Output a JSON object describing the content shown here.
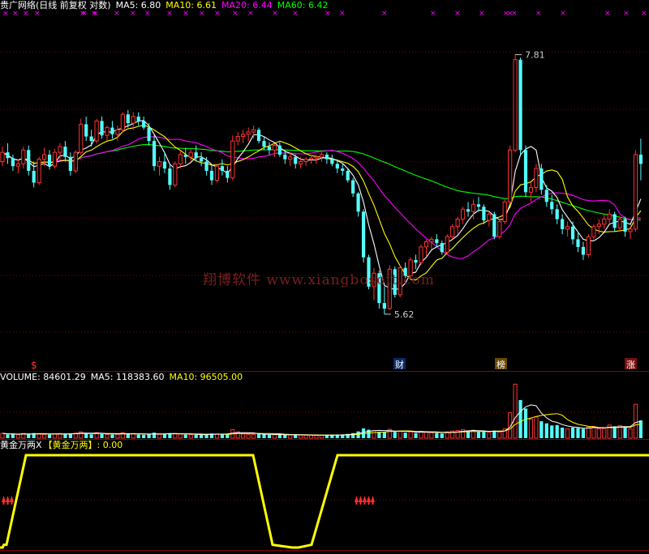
{
  "price_header": {
    "title": "贵广网络(日线 前复权 对数)",
    "ma5": "MA5: 6.80",
    "ma10": "MA10: 6.61",
    "ma20": "MA20: 6.44",
    "ma60": "MA60: 6.42"
  },
  "volume_header": {
    "volume": "VOLUME: 84601.29",
    "ma5": "MA5: 118383.60",
    "ma10": "MA10: 96505.00"
  },
  "indicator_header": {
    "name": "黄金万两X",
    "line": "【黄金万两】: 0.00"
  },
  "watermark": "翔博软件 www.xiangbosoft.com",
  "price_annotations": {
    "high_label": "7.81",
    "low_label": "5.62",
    "marker_s": "$",
    "marker_cai": "财",
    "marker_bang": "榜",
    "marker_zhang": "涨"
  },
  "colors": {
    "background": "#000000",
    "up": "#ff3232",
    "down": "#54ffff",
    "ma5": "#ffffff",
    "ma10": "#ffff00",
    "ma20": "#ff00ff",
    "ma60": "#00ff00",
    "signal": "#ffff00",
    "grid": "#8b0000",
    "marker_x": "#ff00ff"
  },
  "chart_data": {
    "type": "candlestick",
    "scale": "log",
    "ylim": [
      5.3,
      8.2
    ],
    "candles": [
      [
        6.82,
        6.95,
        6.78,
        6.9
      ],
      [
        6.9,
        6.98,
        6.8,
        6.85
      ],
      [
        6.85,
        6.88,
        6.74,
        6.78
      ],
      [
        6.78,
        6.84,
        6.72,
        6.8
      ],
      [
        6.8,
        6.95,
        6.76,
        6.92
      ],
      [
        6.92,
        6.96,
        6.7,
        6.74
      ],
      [
        6.74,
        6.82,
        6.6,
        6.64
      ],
      [
        6.64,
        6.86,
        6.62,
        6.84
      ],
      [
        6.84,
        6.94,
        6.78,
        6.88
      ],
      [
        6.88,
        6.92,
        6.75,
        6.78
      ],
      [
        6.78,
        6.93,
        6.76,
        6.9
      ],
      [
        6.9,
        6.98,
        6.84,
        6.95
      ],
      [
        6.95,
        7.0,
        6.82,
        6.86
      ],
      [
        6.86,
        6.9,
        6.7,
        6.74
      ],
      [
        6.74,
        6.92,
        6.72,
        6.9
      ],
      [
        6.9,
        7.2,
        6.88,
        7.15
      ],
      [
        7.15,
        7.22,
        7.0,
        7.04
      ],
      [
        7.04,
        7.1,
        6.95,
        7.0
      ],
      [
        7.0,
        7.2,
        6.98,
        7.18
      ],
      [
        7.18,
        7.22,
        7.02,
        7.05
      ],
      [
        7.05,
        7.14,
        7.0,
        7.12
      ],
      [
        7.12,
        7.18,
        7.02,
        7.06
      ],
      [
        7.06,
        7.14,
        7.0,
        7.1
      ],
      [
        7.1,
        7.26,
        7.08,
        7.24
      ],
      [
        7.24,
        7.28,
        7.12,
        7.16
      ],
      [
        7.16,
        7.26,
        7.1,
        7.22
      ],
      [
        7.22,
        7.26,
        7.14,
        7.18
      ],
      [
        7.18,
        7.22,
        7.1,
        7.12
      ],
      [
        7.12,
        7.16,
        6.96,
        7.0
      ],
      [
        7.0,
        7.05,
        6.74,
        6.78
      ],
      [
        6.78,
        6.86,
        6.7,
        6.82
      ],
      [
        6.82,
        6.9,
        6.72,
        6.76
      ],
      [
        6.76,
        6.8,
        6.58,
        6.62
      ],
      [
        6.62,
        6.82,
        6.6,
        6.8
      ],
      [
        6.8,
        6.92,
        6.76,
        6.88
      ],
      [
        6.88,
        6.94,
        6.8,
        6.86
      ],
      [
        6.86,
        6.93,
        6.82,
        6.9
      ],
      [
        6.9,
        6.96,
        6.82,
        6.85
      ],
      [
        6.85,
        6.9,
        6.78,
        6.82
      ],
      [
        6.82,
        6.86,
        6.7,
        6.74
      ],
      [
        6.74,
        6.8,
        6.62,
        6.66
      ],
      [
        6.66,
        6.8,
        6.64,
        6.78
      ],
      [
        6.78,
        6.84,
        6.7,
        6.74
      ],
      [
        6.74,
        6.78,
        6.64,
        6.68
      ],
      [
        6.68,
        7.05,
        6.66,
        7.0
      ],
      [
        7.0,
        7.08,
        6.96,
        7.04
      ],
      [
        7.04,
        7.1,
        6.98,
        7.06
      ],
      [
        7.06,
        7.12,
        7.0,
        7.08
      ],
      [
        7.08,
        7.14,
        7.02,
        7.1
      ],
      [
        7.1,
        7.12,
        6.98,
        7.0
      ],
      [
        7.0,
        7.04,
        6.92,
        6.95
      ],
      [
        6.95,
        6.99,
        6.88,
        6.92
      ],
      [
        6.92,
        6.98,
        6.86,
        6.96
      ],
      [
        6.96,
        6.99,
        6.86,
        6.88
      ],
      [
        6.88,
        6.92,
        6.8,
        6.84
      ],
      [
        6.84,
        6.9,
        6.78,
        6.86
      ],
      [
        6.86,
        6.88,
        6.76,
        6.8
      ],
      [
        6.8,
        6.86,
        6.76,
        6.82
      ],
      [
        6.82,
        6.86,
        6.78,
        6.84
      ],
      [
        6.84,
        6.88,
        6.8,
        6.85
      ],
      [
        6.85,
        6.88,
        6.8,
        6.86
      ],
      [
        6.86,
        6.9,
        6.82,
        6.88
      ],
      [
        6.88,
        6.9,
        6.8,
        6.84
      ],
      [
        6.84,
        6.88,
        6.78,
        6.8
      ],
      [
        6.8,
        6.84,
        6.72,
        6.76
      ],
      [
        6.76,
        6.8,
        6.7,
        6.74
      ],
      [
        6.74,
        6.76,
        6.64,
        6.66
      ],
      [
        6.66,
        6.68,
        6.52,
        6.55
      ],
      [
        6.55,
        6.56,
        6.36,
        6.4
      ],
      [
        6.4,
        6.42,
        6.0,
        6.04
      ],
      [
        6.04,
        6.06,
        5.8,
        5.82
      ],
      [
        5.82,
        5.96,
        5.72,
        5.92
      ],
      [
        5.92,
        5.94,
        5.66,
        5.7
      ],
      [
        5.7,
        5.82,
        5.62,
        5.66
      ],
      [
        5.66,
        5.98,
        5.65,
        5.95
      ],
      [
        5.95,
        5.97,
        5.74,
        5.76
      ],
      [
        5.76,
        5.98,
        5.74,
        5.96
      ],
      [
        5.96,
        6.0,
        5.88,
        5.9
      ],
      [
        5.9,
        6.04,
        5.88,
        6.02
      ],
      [
        6.02,
        6.06,
        5.95,
        6.0
      ],
      [
        6.0,
        6.14,
        5.98,
        6.12
      ],
      [
        6.12,
        6.18,
        6.05,
        6.16
      ],
      [
        6.16,
        6.2,
        6.1,
        6.18
      ],
      [
        6.18,
        6.22,
        6.12,
        6.15
      ],
      [
        6.15,
        6.17,
        6.06,
        6.08
      ],
      [
        6.08,
        6.22,
        6.06,
        6.2
      ],
      [
        6.2,
        6.3,
        6.18,
        6.28
      ],
      [
        6.28,
        6.36,
        6.22,
        6.34
      ],
      [
        6.34,
        6.44,
        6.3,
        6.42
      ],
      [
        6.42,
        6.48,
        6.36,
        6.4
      ],
      [
        6.4,
        6.5,
        6.34,
        6.46
      ],
      [
        6.46,
        6.52,
        6.4,
        6.44
      ],
      [
        6.44,
        6.46,
        6.3,
        6.33
      ],
      [
        6.33,
        6.4,
        6.28,
        6.38
      ],
      [
        6.38,
        6.4,
        6.18,
        6.2
      ],
      [
        6.2,
        6.34,
        6.18,
        6.32
      ],
      [
        6.32,
        6.5,
        6.3,
        6.48
      ],
      [
        6.48,
        6.96,
        6.46,
        6.92
      ],
      [
        6.92,
        7.81,
        6.9,
        7.76
      ],
      [
        7.76,
        7.78,
        6.88,
        6.92
      ],
      [
        6.92,
        6.96,
        6.52,
        6.56
      ],
      [
        6.56,
        6.64,
        6.48,
        6.6
      ],
      [
        6.6,
        6.8,
        6.56,
        6.76
      ],
      [
        6.76,
        6.8,
        6.54,
        6.58
      ],
      [
        6.58,
        6.62,
        6.44,
        6.48
      ],
      [
        6.48,
        6.54,
        6.38,
        6.42
      ],
      [
        6.42,
        6.46,
        6.3,
        6.34
      ],
      [
        6.34,
        6.38,
        6.22,
        6.26
      ],
      [
        6.26,
        6.32,
        6.2,
        6.28
      ],
      [
        6.28,
        6.32,
        6.14,
        6.18
      ],
      [
        6.18,
        6.24,
        6.08,
        6.12
      ],
      [
        6.12,
        6.16,
        6.02,
        6.06
      ],
      [
        6.06,
        6.22,
        6.04,
        6.2
      ],
      [
        6.2,
        6.3,
        6.18,
        6.28
      ],
      [
        6.28,
        6.34,
        6.22,
        6.3
      ],
      [
        6.3,
        6.38,
        6.26,
        6.34
      ],
      [
        6.34,
        6.42,
        6.3,
        6.38
      ],
      [
        6.38,
        6.4,
        6.24,
        6.27
      ],
      [
        6.27,
        6.36,
        6.24,
        6.34
      ],
      [
        6.34,
        6.36,
        6.2,
        6.24
      ],
      [
        6.24,
        6.28,
        6.18,
        6.26
      ],
      [
        6.26,
        6.92,
        6.24,
        6.88
      ],
      [
        6.88,
        7.02,
        6.66,
        6.8
      ]
    ],
    "volume": [
      [
        0.23,
        1
      ],
      [
        0.18,
        0
      ],
      [
        0.2,
        0
      ],
      [
        0.16,
        1
      ],
      [
        0.22,
        1
      ],
      [
        0.2,
        0
      ],
      [
        0.24,
        0
      ],
      [
        0.22,
        1
      ],
      [
        0.18,
        1
      ],
      [
        0.17,
        0
      ],
      [
        0.2,
        1
      ],
      [
        0.22,
        1
      ],
      [
        0.2,
        0
      ],
      [
        0.22,
        0
      ],
      [
        0.24,
        1
      ],
      [
        0.3,
        1
      ],
      [
        0.22,
        0
      ],
      [
        0.18,
        0
      ],
      [
        0.26,
        1
      ],
      [
        0.2,
        0
      ],
      [
        0.18,
        1
      ],
      [
        0.17,
        0
      ],
      [
        0.18,
        1
      ],
      [
        0.26,
        1
      ],
      [
        0.2,
        0
      ],
      [
        0.22,
        1
      ],
      [
        0.17,
        0
      ],
      [
        0.16,
        0
      ],
      [
        0.2,
        0
      ],
      [
        0.26,
        0
      ],
      [
        0.18,
        1
      ],
      [
        0.2,
        0
      ],
      [
        0.24,
        0
      ],
      [
        0.22,
        1
      ],
      [
        0.2,
        1
      ],
      [
        0.17,
        0
      ],
      [
        0.16,
        1
      ],
      [
        0.16,
        0
      ],
      [
        0.15,
        0
      ],
      [
        0.2,
        0
      ],
      [
        0.22,
        0
      ],
      [
        0.2,
        1
      ],
      [
        0.18,
        0
      ],
      [
        0.2,
        0
      ],
      [
        0.4,
        1
      ],
      [
        0.3,
        1
      ],
      [
        0.2,
        1
      ],
      [
        0.18,
        1
      ],
      [
        0.17,
        1
      ],
      [
        0.2,
        0
      ],
      [
        0.18,
        0
      ],
      [
        0.16,
        0
      ],
      [
        0.16,
        1
      ],
      [
        0.16,
        0
      ],
      [
        0.17,
        0
      ],
      [
        0.15,
        1
      ],
      [
        0.16,
        0
      ],
      [
        0.15,
        1
      ],
      [
        0.14,
        1
      ],
      [
        0.14,
        1
      ],
      [
        0.13,
        1
      ],
      [
        0.14,
        1
      ],
      [
        0.15,
        0
      ],
      [
        0.16,
        0
      ],
      [
        0.17,
        0
      ],
      [
        0.16,
        0
      ],
      [
        0.2,
        0
      ],
      [
        0.24,
        0
      ],
      [
        0.32,
        0
      ],
      [
        0.46,
        0
      ],
      [
        0.4,
        0
      ],
      [
        0.36,
        1
      ],
      [
        0.3,
        0
      ],
      [
        0.28,
        0
      ],
      [
        0.42,
        1
      ],
      [
        0.3,
        0
      ],
      [
        0.34,
        1
      ],
      [
        0.26,
        0
      ],
      [
        0.3,
        1
      ],
      [
        0.24,
        0
      ],
      [
        0.32,
        1
      ],
      [
        0.3,
        1
      ],
      [
        0.26,
        1
      ],
      [
        0.24,
        0
      ],
      [
        0.22,
        0
      ],
      [
        0.3,
        1
      ],
      [
        0.34,
        1
      ],
      [
        0.36,
        1
      ],
      [
        0.4,
        1
      ],
      [
        0.34,
        0
      ],
      [
        0.38,
        1
      ],
      [
        0.3,
        0
      ],
      [
        0.3,
        0
      ],
      [
        0.28,
        1
      ],
      [
        0.36,
        0
      ],
      [
        0.3,
        1
      ],
      [
        0.44,
        1
      ],
      [
        1.2,
        1
      ],
      [
        2.55,
        1
      ],
      [
        1.8,
        0
      ],
      [
        1.4,
        0
      ],
      [
        0.9,
        1
      ],
      [
        1.0,
        1
      ],
      [
        0.8,
        0
      ],
      [
        0.7,
        0
      ],
      [
        0.6,
        0
      ],
      [
        0.62,
        0
      ],
      [
        0.5,
        0
      ],
      [
        0.44,
        1
      ],
      [
        0.5,
        0
      ],
      [
        0.48,
        0
      ],
      [
        0.44,
        0
      ],
      [
        0.52,
        1
      ],
      [
        0.56,
        1
      ],
      [
        0.44,
        1
      ],
      [
        0.46,
        1
      ],
      [
        0.62,
        1
      ],
      [
        0.56,
        0
      ],
      [
        0.6,
        1
      ],
      [
        0.5,
        0
      ],
      [
        0.44,
        1
      ],
      [
        1.6,
        1
      ],
      [
        0.84,
        0
      ]
    ],
    "signal": [
      [
        0,
        0
      ],
      [
        0.4,
        0
      ],
      [
        0.6,
        0.03
      ],
      [
        1,
        0.03
      ],
      [
        4,
        1
      ],
      [
        32,
        1
      ],
      [
        35,
        1
      ],
      [
        39,
        1
      ],
      [
        42,
        0.03
      ],
      [
        45,
        0
      ],
      [
        46,
        0
      ],
      [
        48,
        0.03
      ],
      [
        52,
        1
      ],
      [
        60,
        1
      ],
      [
        76,
        1
      ],
      [
        100,
        1
      ]
    ],
    "signal_arrows_at": [
      1,
      9.5,
      24.6,
      93.3,
      100
    ]
  }
}
